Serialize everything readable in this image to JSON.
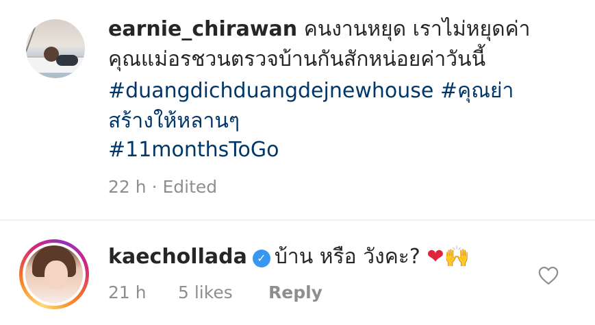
{
  "caption": {
    "username": "earnie_chirawan",
    "line1_text": "คนงานหยุด เราไม่หยุดค่า",
    "line2_text": "คุณแม่อรชวนตรวจบ้านกันสักหน่อยค่าวันนี้",
    "hashtag1": "#duangdichduangdejnewhouse",
    "hashtag2_part1": "#คุณย่า",
    "hashtag2_part2": "สร้างให้หลานๆ",
    "hashtag3": "#11monthsToGo",
    "time": "22 h",
    "separator": "·",
    "edited": "Edited"
  },
  "reply": {
    "username": "kaechollada",
    "verified_icon": "verified-badge-icon",
    "text": "บ้าน หรือ วังคะ?",
    "emoji1": "❤",
    "emoji2": "🙌",
    "time": "21 h",
    "likes": "5 likes",
    "reply_label": "Reply",
    "like_icon": "heart-outline-icon"
  },
  "colors": {
    "text": "#262626",
    "hashtag": "#00376b",
    "meta": "#8e8e8e",
    "verified": "#3897f0",
    "heart": "#e0243a"
  }
}
